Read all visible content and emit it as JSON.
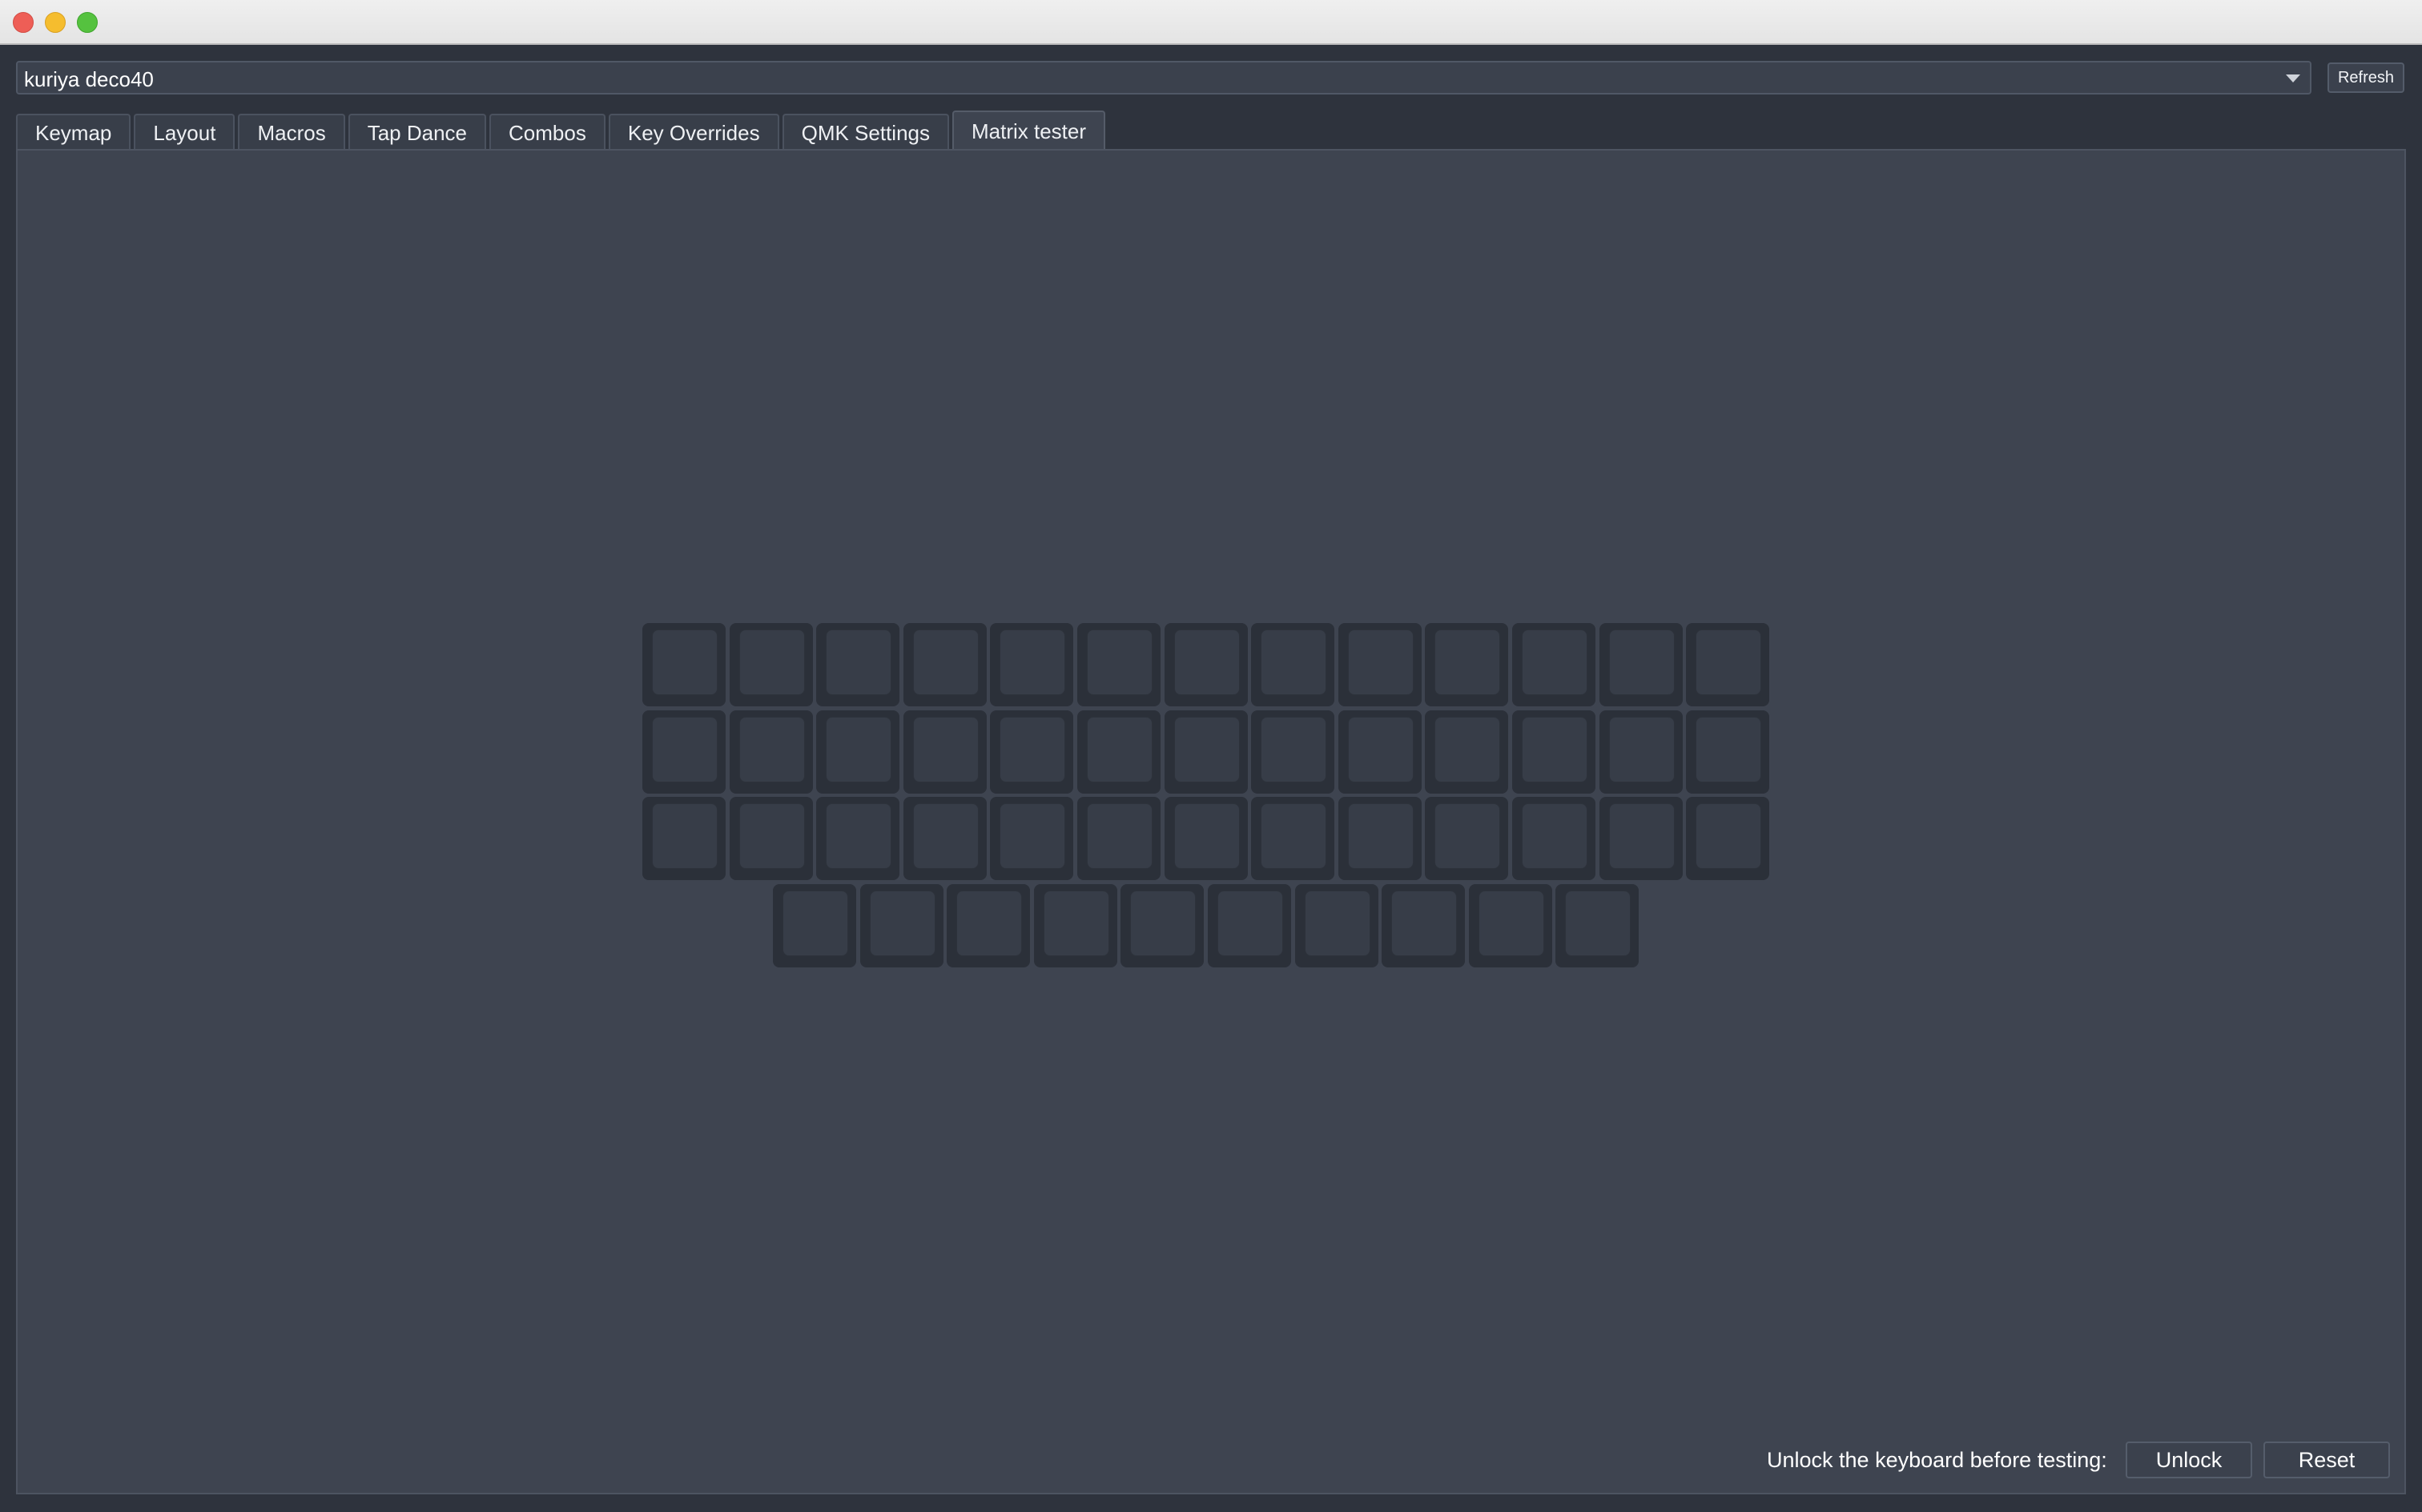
{
  "window": {
    "controls": [
      "close",
      "minimize",
      "maximize"
    ]
  },
  "device": {
    "selected": "kuriya deco40",
    "dropdown_icon": "chevron-down-icon"
  },
  "toolbar": {
    "refresh_label": "Refresh"
  },
  "tabs": [
    {
      "label": "Keymap",
      "active": false
    },
    {
      "label": "Layout",
      "active": false
    },
    {
      "label": "Macros",
      "active": false
    },
    {
      "label": "Tap Dance",
      "active": false
    },
    {
      "label": "Combos",
      "active": false
    },
    {
      "label": "Key Overrides",
      "active": false
    },
    {
      "label": "QMK Settings",
      "active": false
    },
    {
      "label": "Matrix tester",
      "active": true
    }
  ],
  "matrix": {
    "row_key_counts": [
      13,
      13,
      13,
      10
    ],
    "pressed_keys": []
  },
  "footer": {
    "message": "Unlock the keyboard before testing:",
    "unlock_label": "Unlock",
    "reset_label": "Reset"
  }
}
